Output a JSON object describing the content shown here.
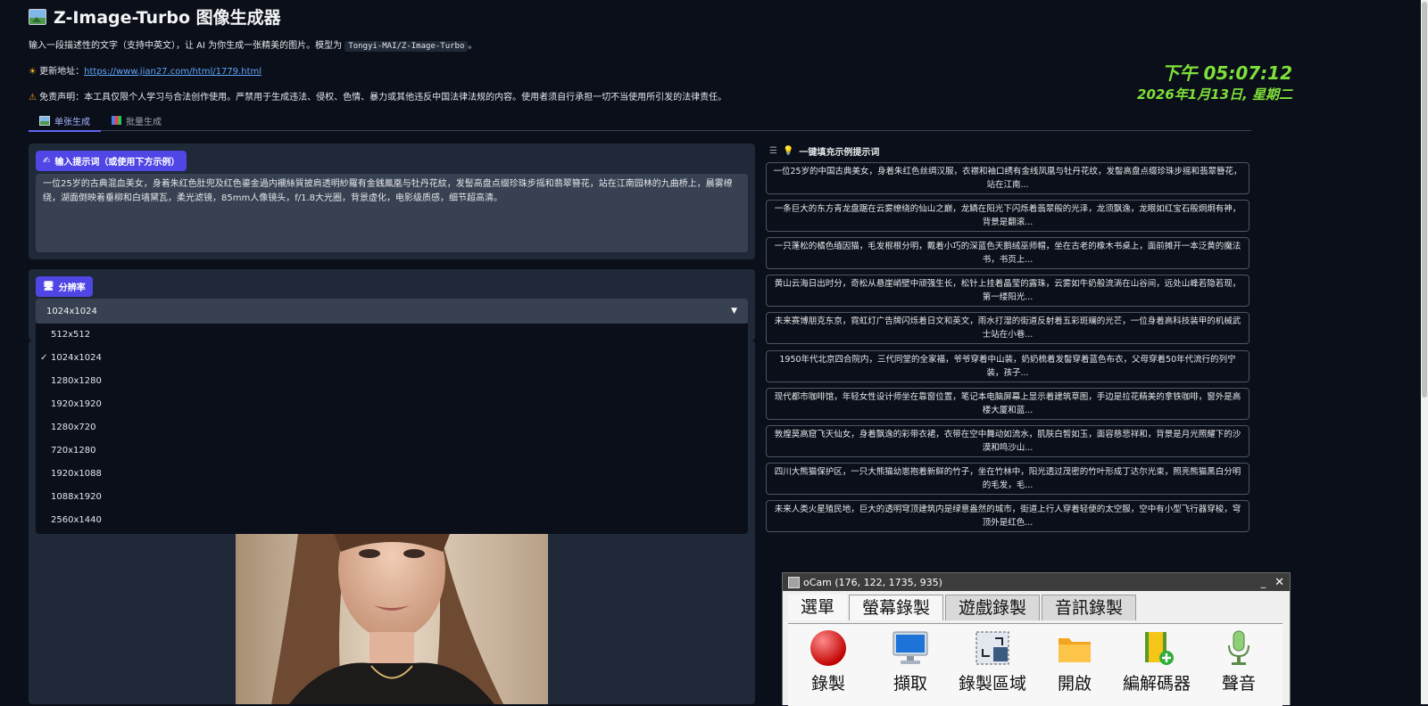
{
  "header": {
    "title": "Z-Image-Turbo 图像生成器",
    "desc_prefix": "输入一段描述性的文字（支持中英文），让 AI 为你生成一张精美的图片。模型为 ",
    "model": "Tongyi-MAI/Z-Image-Turbo",
    "desc_suffix": "。",
    "update_label": "更新地址：",
    "update_url": "https://www.jian27.com/html/1779.html",
    "disclaimer": "免责声明：本工具仅限个人学习与合法创作使用。严禁用于生成违法、侵权、色情、暴力或其他违反中国法律法规的内容。使用者须自行承担一切不当使用所引发的法律责任。"
  },
  "clock": {
    "time": "下午 05:07:12",
    "date": "2026年1月13日, 星期二"
  },
  "tabs": [
    {
      "label": "单张生成"
    },
    {
      "label": "批量生成"
    }
  ],
  "prompt": {
    "label": "输入提示词（或使用下方示例）",
    "value": "一位25岁的古典混血美女，身着朱红色肚兜及红色鎏金過内襯絲質披肩透明紗羅有金銭鳳凰与牡丹花紋，发髻高盘点缀珍珠步摇和翡翠簪花，站在江南园林的九曲桥上，晨雾缭绕，湖面倒映着垂柳和白墙黛瓦，柔光滤镜，85mm人像镜头，f/1.8大光圈，背景虚化，电影级质感，细节超高清。"
  },
  "resolution": {
    "label": "分辨率",
    "selected": "1024x1024",
    "options": [
      "512x512",
      "1024x1024",
      "1280x1280",
      "1920x1920",
      "1280x720",
      "720x1280",
      "1920x1088",
      "1088x1920",
      "2560x1440"
    ]
  },
  "examples": {
    "heading": "一键填充示例提示词",
    "items": [
      "一位25岁的中国古典美女，身着朱红色丝绸汉服，衣襟和袖口绣有金线凤凰与牡丹花纹，发髻高盘点缀珍珠步摇和翡翠簪花，站在江南...",
      "一条巨大的东方青龙盘踞在云雾缭绕的仙山之巅，龙鳞在阳光下闪烁着翡翠般的光泽，龙须飘逸，龙眼如红宝石般炯炯有神，背景是翻滚...",
      "一只蓬松的橘色缅因猫，毛发根根分明，戴着小巧的深蓝色天鹅绒巫师帽，坐在古老的橡木书桌上，面前摊开一本泛黄的魔法书，书页上...",
      "黄山云海日出时分，奇松从悬崖峭壁中顽强生长，松针上挂着晶莹的露珠，云雾如牛奶般流淌在山谷间，远处山峰若隐若现，第一缕阳光...",
      "未来赛博朋克东京，霓虹灯广告牌闪烁着日文和英文，雨水打湿的街道反射着五彩斑斓的光芒，一位身着高科技装甲的机械武士站在小巷...",
      "1950年代北京四合院内，三代同堂的全家福，爷爷穿着中山装，奶奶梳着发髻穿着蓝色布衣，父母穿着50年代流行的列宁装，孩子...",
      "现代都市咖啡馆，年轻女性设计师坐在靠窗位置，笔记本电脑屏幕上显示着建筑草图，手边是拉花精美的拿铁咖啡，窗外是高楼大厦和蓝...",
      "敦煌莫高窟飞天仙女，身着飘逸的彩带衣裙，衣带在空中舞动如流水，肌肤白皙如玉，面容慈悲祥和，背景是月光照耀下的沙漠和鸣沙山...",
      "四川大熊猫保护区，一只大熊猫幼崽抱着新鲜的竹子，坐在竹林中，阳光透过茂密的竹叶形成丁达尔光束，照亮熊猫黑白分明的毛发，毛...",
      "未来人类火星殖民地，巨大的透明穹顶建筑内是绿意盎然的城市，街道上行人穿着轻便的太空服，空中有小型飞行器穿梭，穹顶外是红色..."
    ]
  },
  "ocam": {
    "title": "oCam (176, 122, 1735, 935)",
    "tabs": [
      "選單",
      "螢幕錄製",
      "遊戲錄製",
      "音訊錄製"
    ],
    "tools": [
      "錄製",
      "擷取",
      "錄製區域",
      "開啟",
      "編解碼器",
      "聲音"
    ]
  }
}
